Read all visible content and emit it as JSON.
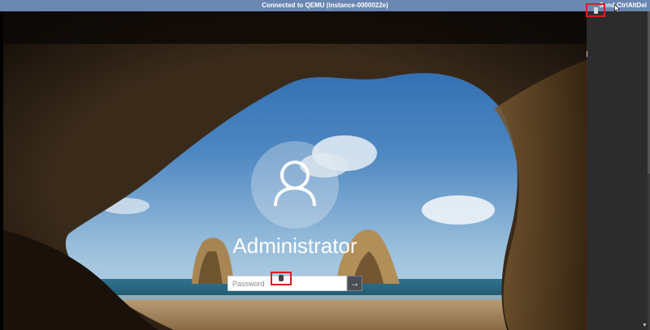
{
  "console": {
    "title": "Connected to QEMU (instance-0000022e)",
    "send_cad_label": "Send CtrlAltDel"
  },
  "login": {
    "username": "Administrator",
    "password_placeholder": "Password",
    "submit_icon": "arrow-right-icon",
    "avatar_icon": "user-icon"
  },
  "colors": {
    "topbar": "#6b87b1",
    "annotation": "#d81e1e",
    "right_gutter": "#2c2c2c"
  }
}
